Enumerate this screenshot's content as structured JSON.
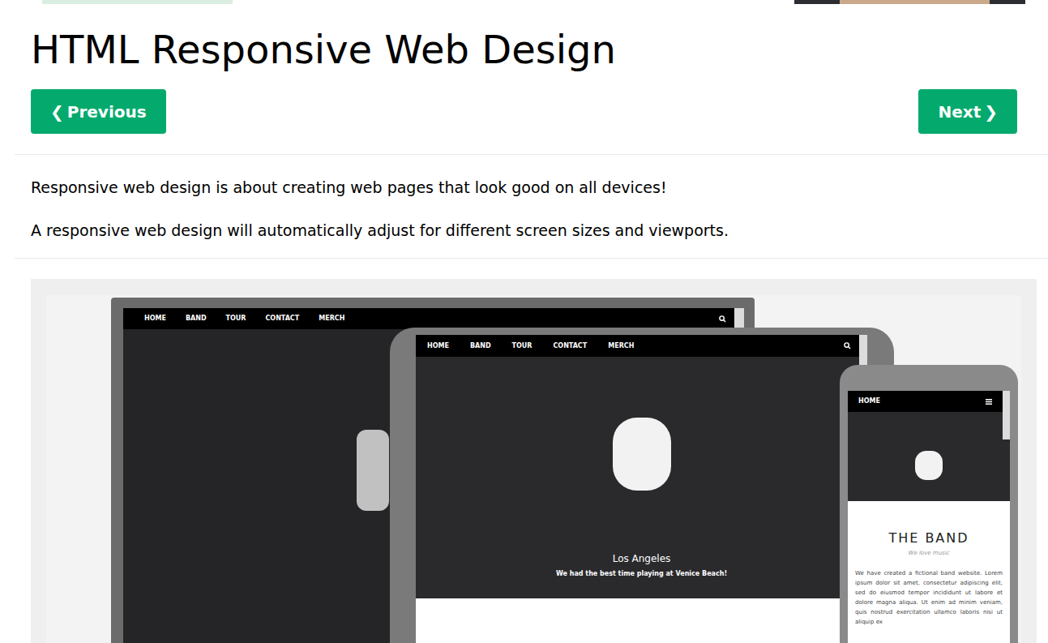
{
  "page": {
    "title": "HTML Responsive Web Design"
  },
  "navigation": {
    "previous": {
      "icon": "❮",
      "label": "Previous"
    },
    "next": {
      "label": "Next",
      "icon": "❯"
    }
  },
  "intro": [
    "Responsive web design is about creating web pages that look good on all devices!",
    "A responsive web design will automatically adjust for different screen sizes and viewports."
  ],
  "illustration": {
    "laptop": {
      "menu": [
        "HOME",
        "BAND",
        "TOUR",
        "CONTACT",
        "MERCH"
      ]
    },
    "tablet": {
      "menu": [
        "HOME",
        "BAND",
        "TOUR",
        "CONTACT",
        "MERCH"
      ],
      "caption": "Los Angeles",
      "subcaption": "We had the best time playing at Venice Beach!"
    },
    "phone": {
      "menu": [
        "HOME"
      ],
      "heading": "THE BAND",
      "tagline": "We love music",
      "body": "We have created a fictional band website. Lorem ipsum dolor sit amet, consectetur adipiscing elit, sed do eiusmod tempor incididunt ut labore et dolore magna aliqua. Ut enim ad minim veniam, quis nostrud exercitation ullamco laboris nisi ut aliquip ex"
    }
  }
}
